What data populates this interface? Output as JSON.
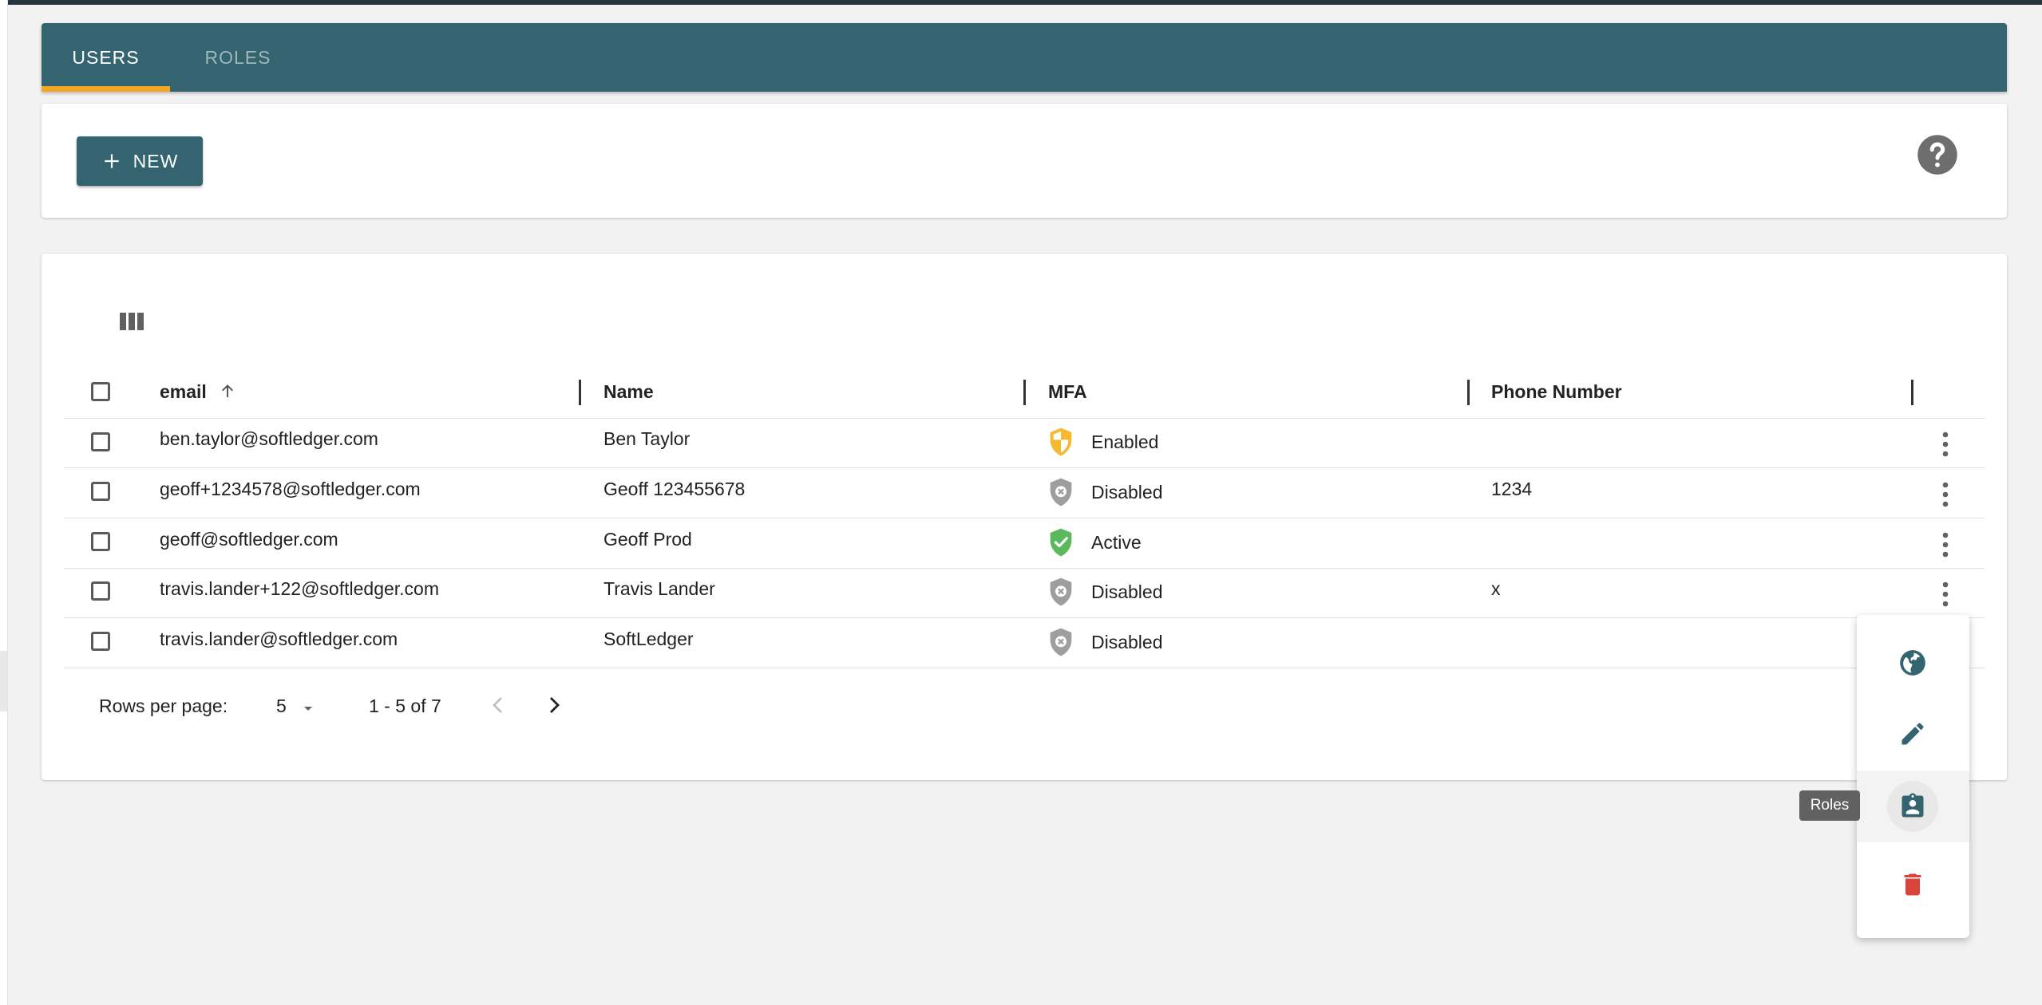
{
  "tabs": [
    {
      "label": "USERS"
    },
    {
      "label": "ROLES"
    }
  ],
  "toolbar": {
    "new_label": "NEW",
    "new_icon": "plus-icon",
    "help_icon": "help-circle-icon"
  },
  "table": {
    "columns_icon": "view-column-icon",
    "headers": {
      "email": "email",
      "name": "Name",
      "mfa": "MFA",
      "phone": "Phone Number"
    },
    "sort": {
      "column": "email",
      "direction": "ascending",
      "icon": "arrow-up-icon"
    },
    "rows": [
      {
        "email": "ben.taylor@softledger.com",
        "name": "Ben Taylor",
        "mfa": "Enabled",
        "mfa_icon": "shield-half-icon",
        "phone": ""
      },
      {
        "email": "geoff+1234578@softledger.com",
        "name": "Geoff 123455678",
        "mfa": "Disabled",
        "mfa_icon": "shield-x-icon",
        "phone": "1234"
      },
      {
        "email": "geoff@softledger.com",
        "name": "Geoff Prod",
        "mfa": "Active",
        "mfa_icon": "shield-check-icon",
        "phone": ""
      },
      {
        "email": "travis.lander+122@softledger.com",
        "name": "Travis Lander",
        "mfa": "Disabled",
        "mfa_icon": "shield-x-icon",
        "phone": "x"
      },
      {
        "email": "travis.lander@softledger.com",
        "name": "SoftLedger",
        "mfa": "Disabled",
        "mfa_icon": "shield-x-icon",
        "phone": ""
      }
    ]
  },
  "pagination": {
    "rows_per_page_label": "Rows per page:",
    "rows_per_page_value": "5",
    "range": "1 - 5 of 7"
  },
  "action_menu": {
    "items": [
      {
        "icon": "globe-icon"
      },
      {
        "icon": "pencil-icon"
      },
      {
        "icon": "assignment-ind-icon",
        "tooltip": "Roles"
      },
      {
        "icon": "trash-icon"
      }
    ]
  },
  "colors": {
    "primary": "#336470",
    "accent": "#f5a623",
    "mfa_enabled": "#f5b82e",
    "mfa_disabled": "#9e9e9e",
    "mfa_active": "#5cb85c",
    "delete": "#d9453b"
  }
}
